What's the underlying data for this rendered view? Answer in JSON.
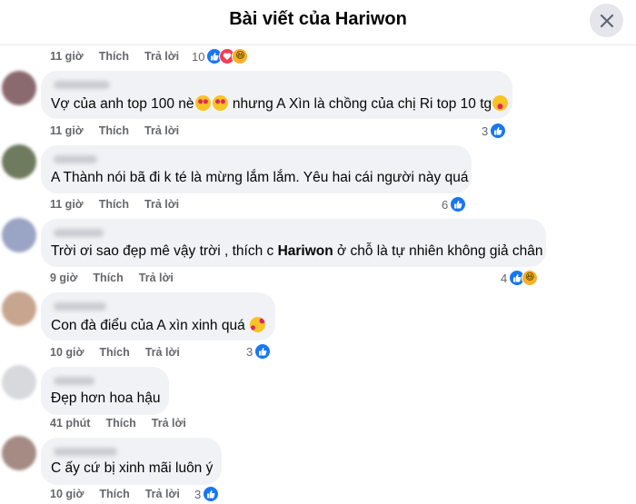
{
  "header": {
    "title": "Bài viết của Hariwon"
  },
  "labels": {
    "like": "Thích",
    "reply": "Trả lời"
  },
  "colors": {
    "like_blue": "#1877f2",
    "love_red": "#f33e58",
    "haha_yellow": "#f7b125",
    "bubble_bg": "#f0f2f5"
  },
  "top_meta": {
    "time": "11 giờ",
    "reaction_count": "10",
    "reactions": [
      "like-icon",
      "love-icon",
      "haha-icon"
    ]
  },
  "comments": [
    {
      "text_before": "Vợ của anh top 100 nè",
      "text_middle": " nhưng A Xìn là chồng của chị Ri top 10 tg",
      "emojis": [
        "heart-eyes-emoji",
        "heart-eyes-emoji",
        "tongue-out-emoji"
      ],
      "time": "11 giờ",
      "reaction_count": "3",
      "reactions": [
        "like-icon"
      ]
    },
    {
      "text": "A Thành nói bã đi k té là mừng lắm lắm. Yêu hai cái người này quá",
      "time": "11 giờ",
      "reaction_count": "6",
      "reactions": [
        "like-icon"
      ]
    },
    {
      "text_before": "Trời ơi sao đẹp mê vậy trời , thích c ",
      "text_bold": "Hariwon",
      "text_after": " ở chỗ là tự nhiên không giả chân",
      "time": "9 giờ",
      "reaction_count": "4",
      "reactions": [
        "like-icon",
        "haha-icon"
      ]
    },
    {
      "text": "Con đà điểu của A xìn xinh quá",
      "emojis": [
        "smiling-hearts-emoji"
      ],
      "time": "10 giờ",
      "reaction_count": "3",
      "reactions": [
        "like-icon"
      ]
    },
    {
      "text": "Đẹp hơn hoa hậu",
      "time": "41 phút"
    },
    {
      "text": "C ấy cứ bị xinh mãi luôn ý",
      "time": "10 giờ",
      "reaction_count": "3",
      "reactions": [
        "like-icon"
      ]
    }
  ]
}
